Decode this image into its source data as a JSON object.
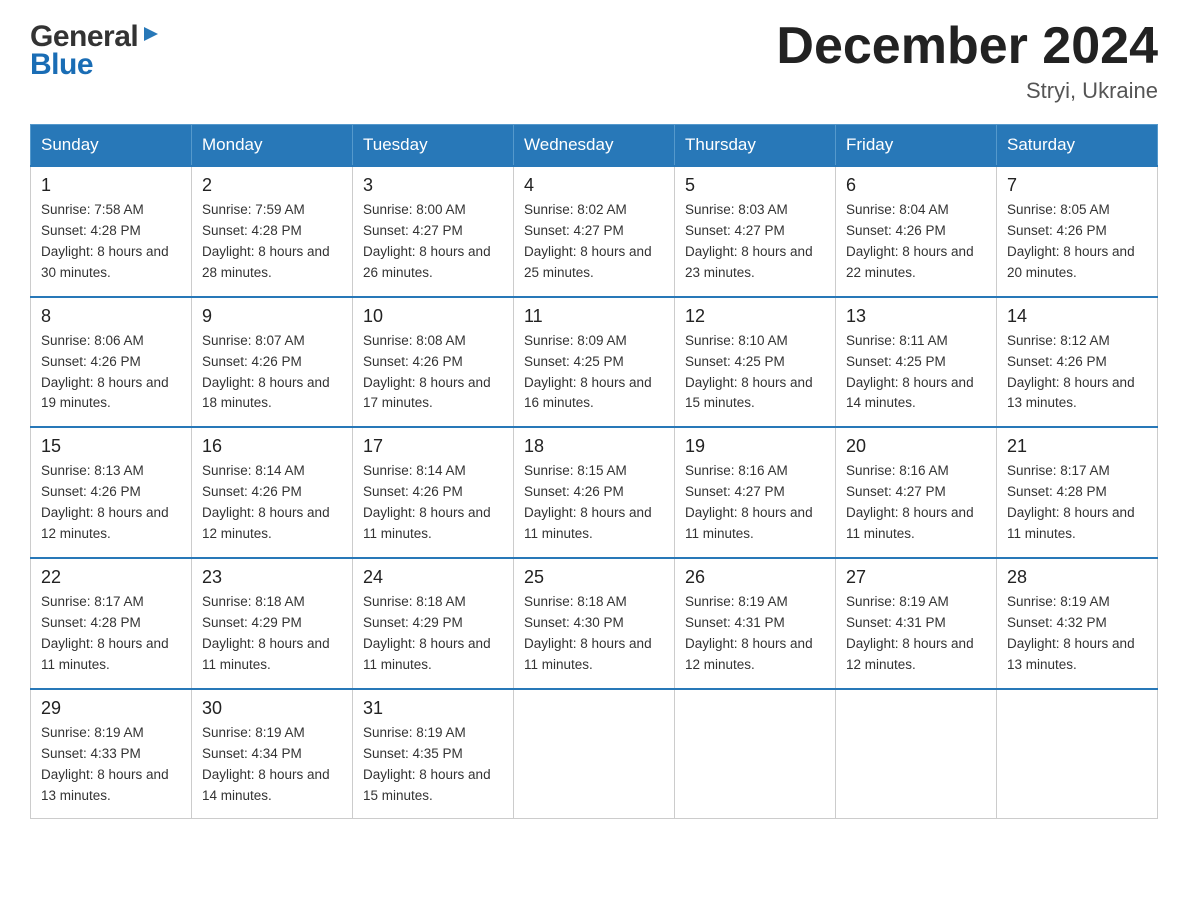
{
  "header": {
    "title": "December 2024",
    "location": "Stryi, Ukraine",
    "logo_general": "General",
    "logo_blue": "Blue"
  },
  "weekdays": [
    "Sunday",
    "Monday",
    "Tuesday",
    "Wednesday",
    "Thursday",
    "Friday",
    "Saturday"
  ],
  "weeks": [
    [
      {
        "day": "1",
        "sunrise": "Sunrise: 7:58 AM",
        "sunset": "Sunset: 4:28 PM",
        "daylight": "Daylight: 8 hours and 30 minutes."
      },
      {
        "day": "2",
        "sunrise": "Sunrise: 7:59 AM",
        "sunset": "Sunset: 4:28 PM",
        "daylight": "Daylight: 8 hours and 28 minutes."
      },
      {
        "day": "3",
        "sunrise": "Sunrise: 8:00 AM",
        "sunset": "Sunset: 4:27 PM",
        "daylight": "Daylight: 8 hours and 26 minutes."
      },
      {
        "day": "4",
        "sunrise": "Sunrise: 8:02 AM",
        "sunset": "Sunset: 4:27 PM",
        "daylight": "Daylight: 8 hours and 25 minutes."
      },
      {
        "day": "5",
        "sunrise": "Sunrise: 8:03 AM",
        "sunset": "Sunset: 4:27 PM",
        "daylight": "Daylight: 8 hours and 23 minutes."
      },
      {
        "day": "6",
        "sunrise": "Sunrise: 8:04 AM",
        "sunset": "Sunset: 4:26 PM",
        "daylight": "Daylight: 8 hours and 22 minutes."
      },
      {
        "day": "7",
        "sunrise": "Sunrise: 8:05 AM",
        "sunset": "Sunset: 4:26 PM",
        "daylight": "Daylight: 8 hours and 20 minutes."
      }
    ],
    [
      {
        "day": "8",
        "sunrise": "Sunrise: 8:06 AM",
        "sunset": "Sunset: 4:26 PM",
        "daylight": "Daylight: 8 hours and 19 minutes."
      },
      {
        "day": "9",
        "sunrise": "Sunrise: 8:07 AM",
        "sunset": "Sunset: 4:26 PM",
        "daylight": "Daylight: 8 hours and 18 minutes."
      },
      {
        "day": "10",
        "sunrise": "Sunrise: 8:08 AM",
        "sunset": "Sunset: 4:26 PM",
        "daylight": "Daylight: 8 hours and 17 minutes."
      },
      {
        "day": "11",
        "sunrise": "Sunrise: 8:09 AM",
        "sunset": "Sunset: 4:25 PM",
        "daylight": "Daylight: 8 hours and 16 minutes."
      },
      {
        "day": "12",
        "sunrise": "Sunrise: 8:10 AM",
        "sunset": "Sunset: 4:25 PM",
        "daylight": "Daylight: 8 hours and 15 minutes."
      },
      {
        "day": "13",
        "sunrise": "Sunrise: 8:11 AM",
        "sunset": "Sunset: 4:25 PM",
        "daylight": "Daylight: 8 hours and 14 minutes."
      },
      {
        "day": "14",
        "sunrise": "Sunrise: 8:12 AM",
        "sunset": "Sunset: 4:26 PM",
        "daylight": "Daylight: 8 hours and 13 minutes."
      }
    ],
    [
      {
        "day": "15",
        "sunrise": "Sunrise: 8:13 AM",
        "sunset": "Sunset: 4:26 PM",
        "daylight": "Daylight: 8 hours and 12 minutes."
      },
      {
        "day": "16",
        "sunrise": "Sunrise: 8:14 AM",
        "sunset": "Sunset: 4:26 PM",
        "daylight": "Daylight: 8 hours and 12 minutes."
      },
      {
        "day": "17",
        "sunrise": "Sunrise: 8:14 AM",
        "sunset": "Sunset: 4:26 PM",
        "daylight": "Daylight: 8 hours and 11 minutes."
      },
      {
        "day": "18",
        "sunrise": "Sunrise: 8:15 AM",
        "sunset": "Sunset: 4:26 PM",
        "daylight": "Daylight: 8 hours and 11 minutes."
      },
      {
        "day": "19",
        "sunrise": "Sunrise: 8:16 AM",
        "sunset": "Sunset: 4:27 PM",
        "daylight": "Daylight: 8 hours and 11 minutes."
      },
      {
        "day": "20",
        "sunrise": "Sunrise: 8:16 AM",
        "sunset": "Sunset: 4:27 PM",
        "daylight": "Daylight: 8 hours and 11 minutes."
      },
      {
        "day": "21",
        "sunrise": "Sunrise: 8:17 AM",
        "sunset": "Sunset: 4:28 PM",
        "daylight": "Daylight: 8 hours and 11 minutes."
      }
    ],
    [
      {
        "day": "22",
        "sunrise": "Sunrise: 8:17 AM",
        "sunset": "Sunset: 4:28 PM",
        "daylight": "Daylight: 8 hours and 11 minutes."
      },
      {
        "day": "23",
        "sunrise": "Sunrise: 8:18 AM",
        "sunset": "Sunset: 4:29 PM",
        "daylight": "Daylight: 8 hours and 11 minutes."
      },
      {
        "day": "24",
        "sunrise": "Sunrise: 8:18 AM",
        "sunset": "Sunset: 4:29 PM",
        "daylight": "Daylight: 8 hours and 11 minutes."
      },
      {
        "day": "25",
        "sunrise": "Sunrise: 8:18 AM",
        "sunset": "Sunset: 4:30 PM",
        "daylight": "Daylight: 8 hours and 11 minutes."
      },
      {
        "day": "26",
        "sunrise": "Sunrise: 8:19 AM",
        "sunset": "Sunset: 4:31 PM",
        "daylight": "Daylight: 8 hours and 12 minutes."
      },
      {
        "day": "27",
        "sunrise": "Sunrise: 8:19 AM",
        "sunset": "Sunset: 4:31 PM",
        "daylight": "Daylight: 8 hours and 12 minutes."
      },
      {
        "day": "28",
        "sunrise": "Sunrise: 8:19 AM",
        "sunset": "Sunset: 4:32 PM",
        "daylight": "Daylight: 8 hours and 13 minutes."
      }
    ],
    [
      {
        "day": "29",
        "sunrise": "Sunrise: 8:19 AM",
        "sunset": "Sunset: 4:33 PM",
        "daylight": "Daylight: 8 hours and 13 minutes."
      },
      {
        "day": "30",
        "sunrise": "Sunrise: 8:19 AM",
        "sunset": "Sunset: 4:34 PM",
        "daylight": "Daylight: 8 hours and 14 minutes."
      },
      {
        "day": "31",
        "sunrise": "Sunrise: 8:19 AM",
        "sunset": "Sunset: 4:35 PM",
        "daylight": "Daylight: 8 hours and 15 minutes."
      },
      null,
      null,
      null,
      null
    ]
  ]
}
